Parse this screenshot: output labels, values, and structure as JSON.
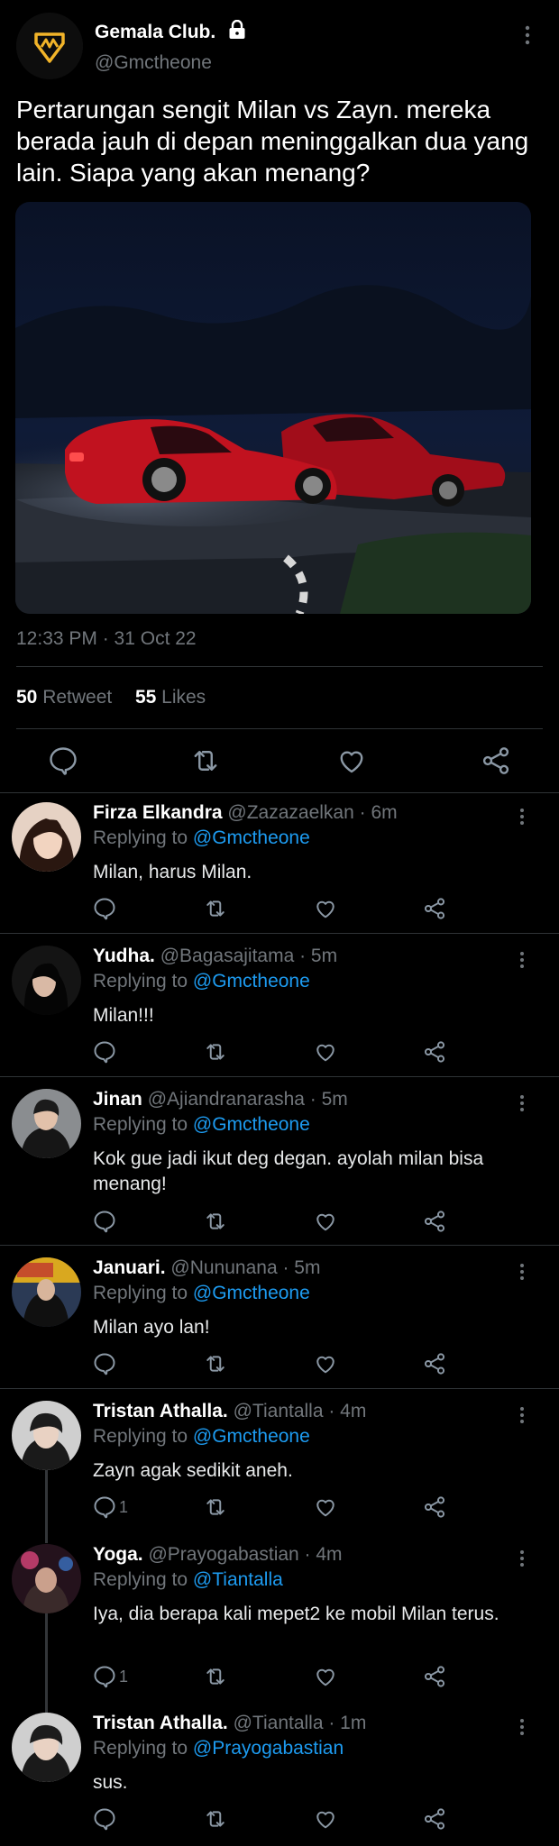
{
  "tweet": {
    "author_name": "Gemala Club.",
    "author_handle": "@Gmctheone",
    "text": "Pertarungan sengit Milan vs Zayn. mereka berada jauh di depan meninggalkan dua yang lain. Siapa yang akan menang?",
    "timestamp": "12:33 PM · 31 Oct 22",
    "retweet_count": "50",
    "retweet_label": "Retweet",
    "likes_count": "55",
    "likes_label": "Likes"
  },
  "replies": [
    {
      "name": "Firza Elkandra",
      "meta": "@Zazazaelkan · 6m",
      "replying_label": "Replying to",
      "replying_to": "@Gmctheone",
      "text": "Milan, harus Milan.",
      "reply_count": ""
    },
    {
      "name": "Yudha.",
      "meta": "@Bagasajitama · 5m",
      "replying_label": "Replying to",
      "replying_to": "@Gmctheone",
      "text": "Milan!!!",
      "reply_count": ""
    },
    {
      "name": "Jinan",
      "meta": "@Ajiandranarasha · 5m",
      "replying_label": "Replying to",
      "replying_to": "@Gmctheone",
      "text": "Kok gue jadi ikut deg degan. ayolah milan bisa menang!",
      "reply_count": ""
    },
    {
      "name": "Januari.",
      "meta": "@Nununana · 5m",
      "replying_label": "Replying to",
      "replying_to": "@Gmctheone",
      "text": "Milan ayo lan!",
      "reply_count": ""
    },
    {
      "name": "Tristan Athalla.",
      "meta": "@Tiantalla · 4m",
      "replying_label": "Replying to",
      "replying_to": "@Gmctheone",
      "text": "Zayn agak sedikit aneh.",
      "reply_count": "1"
    },
    {
      "name": "Yoga.",
      "meta": "@Prayogabastian · 4m",
      "replying_label": "Replying to",
      "replying_to": "@Tiantalla",
      "text": "Iya, dia berapa kali mepet2 ke mobil Milan terus.",
      "reply_count": "1"
    },
    {
      "name": "Tristan Athalla.",
      "meta": "@Tiantalla · 1m",
      "replying_label": "Replying to",
      "replying_to": "@Prayogabastian",
      "text": "sus.",
      "reply_count": ""
    }
  ],
  "icons": {
    "reply": "reply-icon",
    "retweet": "retweet-icon",
    "like": "heart-icon",
    "share": "share-icon",
    "more": "more-vertical-icon",
    "lock": "lock-icon"
  },
  "colors": {
    "background": "#000000",
    "text": "#e7e9ea",
    "muted": "#71767b",
    "link": "#1d9bf0",
    "divider": "#2f3336"
  }
}
